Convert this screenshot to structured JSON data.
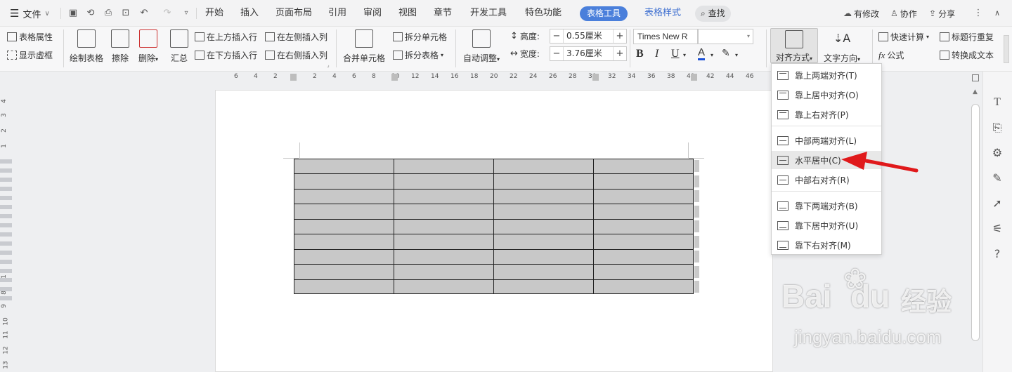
{
  "menubar": {
    "file_label": "文件",
    "tabs": [
      "开始",
      "插入",
      "页面布局",
      "引用",
      "审阅",
      "视图",
      "章节",
      "开发工具",
      "特色功能"
    ],
    "active_tab": "表格工具",
    "style_tab": "表格样式",
    "search_label": "查找",
    "modified_label": "有修改",
    "collab_label": "协作",
    "share_label": "分享"
  },
  "ribbon": {
    "table_props": "表格属性",
    "show_gridlines": "显示虚框",
    "draw_table": "绘制表格",
    "erase": "擦除",
    "delete": "删除",
    "summary": "汇总",
    "insert_above": "在上方插入行",
    "insert_below": "在下方插入行",
    "insert_left": "在左侧插入列",
    "insert_right": "在右侧插入列",
    "merge_cells": "合并单元格",
    "split_cells": "拆分单元格",
    "split_table": "拆分表格",
    "auto_fit": "自动调整",
    "height_label": "高度:",
    "height_value": "0.55厘米",
    "width_label": "宽度:",
    "width_value": "3.76厘米",
    "font_name": "Times New R",
    "align_mode": "对齐方式",
    "text_direction": "文字方向",
    "quick_calc": "快速计算",
    "formula": "公式",
    "repeat_header": "标题行重复",
    "to_text": "转换成文本"
  },
  "ruler": {
    "h_ticks": [
      "6",
      "4",
      "2",
      "2",
      "4",
      "6",
      "8",
      "10",
      "12",
      "14",
      "16",
      "18",
      "20",
      "22",
      "24",
      "26",
      "28",
      "30",
      "32",
      "34",
      "36",
      "38",
      "40",
      "42",
      "44",
      "46"
    ],
    "v_ticks": [
      "4",
      "3",
      "2",
      "1",
      "1",
      "8",
      "9",
      "10",
      "11",
      "12",
      "13"
    ]
  },
  "dropdown": {
    "items": [
      "靠上两端对齐(T)",
      "靠上居中对齐(O)",
      "靠上右对齐(P)",
      "中部两端对齐(L)",
      "水平居中(C)",
      "中部右对齐(R)",
      "靠下两端对齐(B)",
      "靠下居中对齐(U)",
      "靠下右对齐(M)"
    ],
    "highlighted_index": 4
  },
  "watermark": {
    "brand": "Bai",
    "brand2": "du",
    "cn": "经验",
    "url": "jingyan.baidu.com"
  },
  "colors": {
    "accent": "#4a7fdb",
    "arrow": "#e0191b",
    "cell_fill": "#c8c8c8"
  }
}
